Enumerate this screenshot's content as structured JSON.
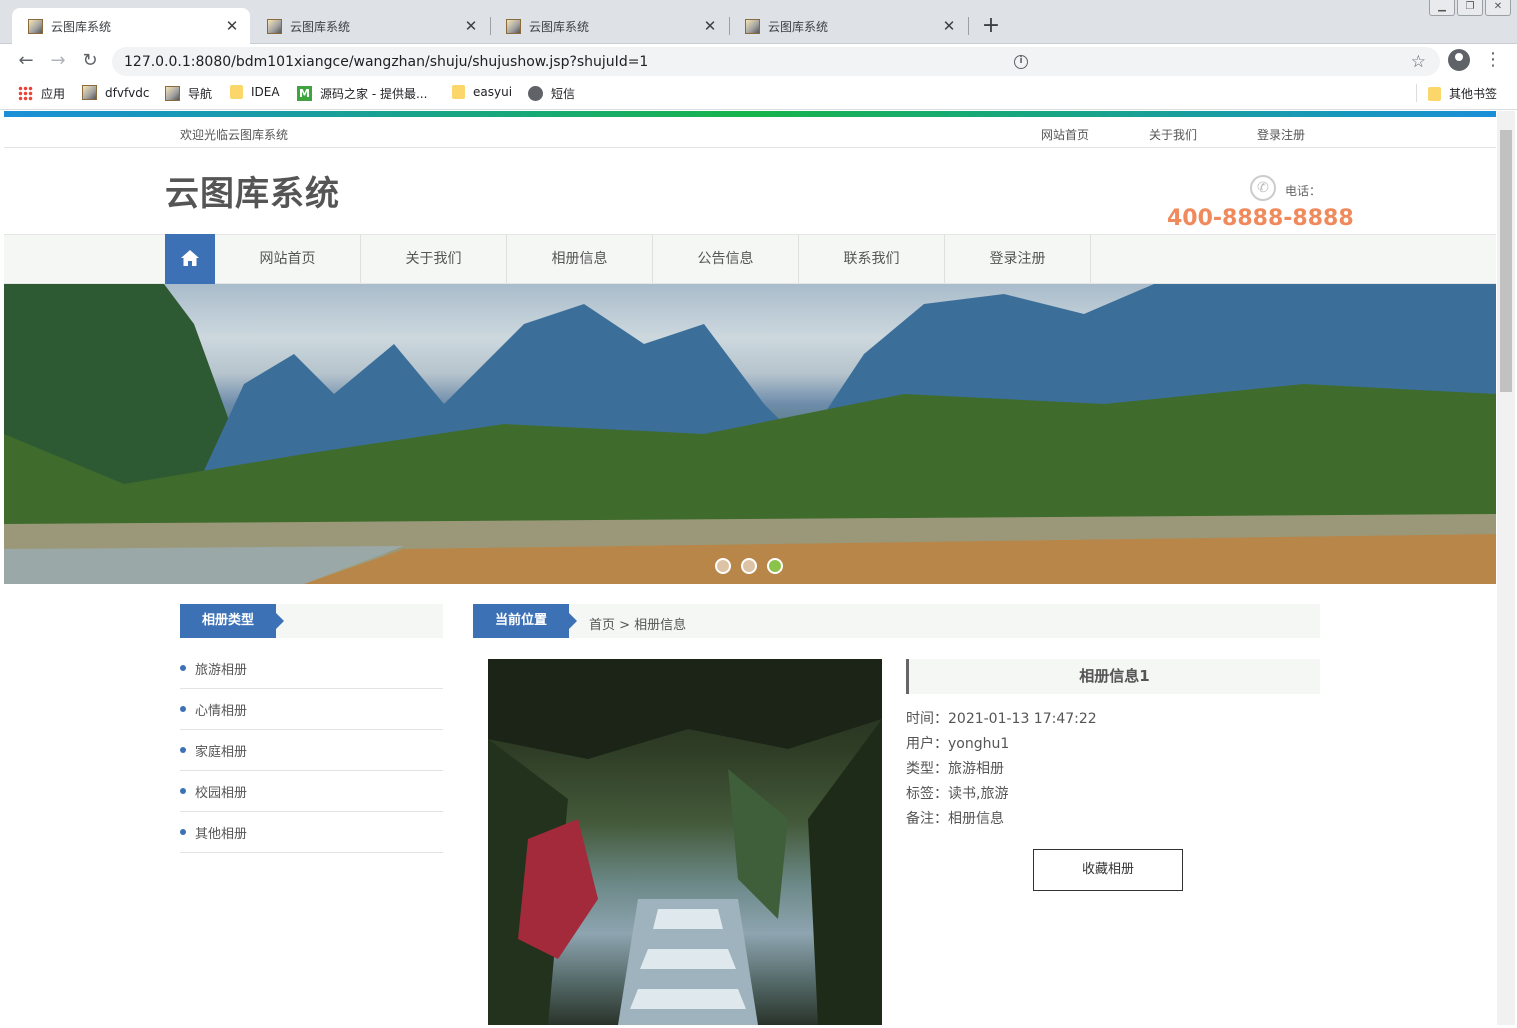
{
  "browser": {
    "tabs": [
      {
        "title": "云图库系统",
        "active": true
      },
      {
        "title": "云图库系统",
        "active": false
      },
      {
        "title": "云图库系统",
        "active": false
      },
      {
        "title": "云图库系统",
        "active": false
      }
    ],
    "new_tab": "+",
    "url": "127.0.0.1:8080/bdm101xiangce/wangzhan/shuju/shujushow.jsp?shujuId=1",
    "bookmarks": [
      {
        "label": "应用",
        "icon": "apps-grid-icon"
      },
      {
        "label": "dfvfvdc",
        "icon": "page-icon"
      },
      {
        "label": "导航",
        "icon": "page-icon"
      },
      {
        "label": "IDEA",
        "icon": "folder-icon"
      },
      {
        "label": "源码之家 - 提供最...",
        "icon": "m-logo-icon"
      },
      {
        "label": "easyui",
        "icon": "folder-icon"
      },
      {
        "label": "短信",
        "icon": "globe-icon"
      }
    ],
    "other_bookmarks": "其他书签"
  },
  "site": {
    "welcome": "欢迎光临云图库系统",
    "top_links": [
      "网站首页",
      "关于我们",
      "登录注册"
    ],
    "logo": "云图库系统",
    "phone_label": "电话：",
    "phone_number": "400-8888-8888",
    "nav": [
      "网站首页",
      "关于我们",
      "相册信息",
      "公告信息",
      "联系我们",
      "登录注册"
    ],
    "banner_dots": 3,
    "banner_active_dot": 3
  },
  "sidebar": {
    "title": "相册类型",
    "categories": [
      "旅游相册",
      "心情相册",
      "家庭相册",
      "校园相册",
      "其他相册"
    ]
  },
  "breadcrumb": {
    "label": "当前位置",
    "path": "首页 > 相册信息"
  },
  "detail": {
    "title": "相册信息1",
    "time": "时间：2021-01-13 17:47:22",
    "user": "用户：yonghu1",
    "type": "类型：旅游相册",
    "tags": "标签：读书,旅游",
    "note": "备注：相册信息",
    "collect_button": "收藏相册"
  },
  "colors": {
    "accent_blue": "#3c71b5",
    "phone_orange": "#f08a5d",
    "nav_bg": "#f5f7f5"
  }
}
